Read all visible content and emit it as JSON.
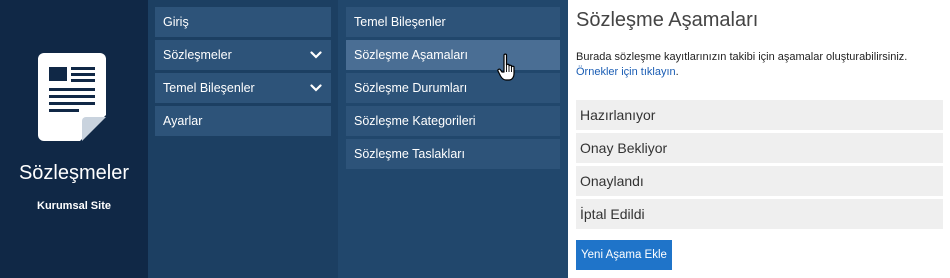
{
  "brand": {
    "title": "Sözleşmeler",
    "subtitle": "Kurumsal Site",
    "icon": "document-icon"
  },
  "menu1": {
    "items": [
      {
        "label": "Giriş",
        "has_chevron": false
      },
      {
        "label": "Sözleşmeler",
        "has_chevron": true
      },
      {
        "label": "Temel Bileşenler",
        "has_chevron": true
      },
      {
        "label": "Ayarlar",
        "has_chevron": false
      }
    ]
  },
  "menu2": {
    "items": [
      {
        "label": "Temel Bileşenler"
      },
      {
        "label": "Sözleşme Aşamaları",
        "active": true
      },
      {
        "label": "Sözleşme Durumları"
      },
      {
        "label": "Sözleşme Kategorileri"
      },
      {
        "label": "Sözleşme Taslakları"
      }
    ]
  },
  "content": {
    "title": "Sözleşme Aşamaları",
    "description": "Burada sözleşme kayıtlarınızın takibi için aşamalar oluşturabilirsiniz.",
    "examples_link": "Örnekler için tıklayın",
    "examples_suffix": ".",
    "stages": [
      "Hazırlanıyor",
      "Onay Bekliyor",
      "Onaylandı",
      "İptal Edildi"
    ],
    "add_button": "Yeni Aşama Ekle"
  },
  "colors": {
    "brand_bg": "#102846",
    "menu1_bg": "#1c3f62",
    "menu2_bg": "#21476c",
    "item_bg": "#2d5379",
    "item_active_bg": "#4a6e94",
    "button_bg": "#1f74c9",
    "link": "#1a5db4"
  }
}
